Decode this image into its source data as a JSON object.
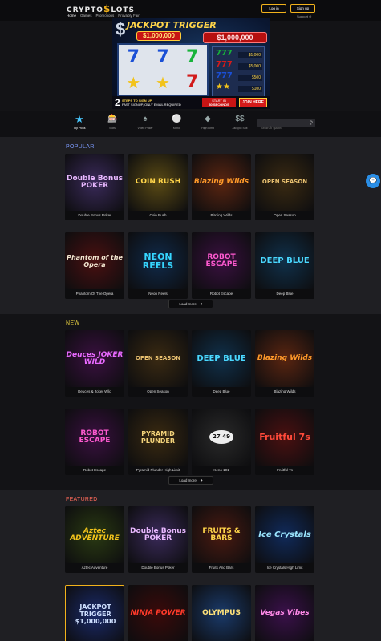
{
  "header": {
    "logo_left": "CRYPTO",
    "logo_mid": "$",
    "logo_right": "LOTS",
    "nav": [
      "Home",
      "Games",
      "Promotions",
      "Provably Fair"
    ],
    "login": "Log in",
    "signup": "Sign up",
    "support": "Support"
  },
  "banner": {
    "title": "JACKPOT TRIGGER",
    "amount": "$1,000,000",
    "amount2": "$1,000,000",
    "mini_pays": [
      "$1,000",
      "$5,000",
      "$500",
      "$100"
    ],
    "step_num": "2",
    "step_line1": "STEPS TO SIGN UP",
    "step_line2": "FAST SIGNUP, ONLY EMAIL REQUIRED",
    "timer_line1": "START IN",
    "timer_line2": "30 SECONDS",
    "join": "JOIN HERE"
  },
  "categories": [
    {
      "label": "Top Picks",
      "icon": "star-icon"
    },
    {
      "label": "Slots",
      "icon": "slots-icon"
    },
    {
      "label": "Video Poker",
      "icon": "spade-icon"
    },
    {
      "label": "Keno",
      "icon": "keno-icon"
    },
    {
      "label": "High Limit",
      "icon": "high-limit-icon"
    },
    {
      "label": "Jackpot Slot",
      "icon": "jackpot-icon"
    }
  ],
  "search": {
    "placeholder": "Search game"
  },
  "popular": {
    "title": "POPULAR",
    "games": [
      {
        "name": "Double Bonus Poker",
        "art": "Double Bonus POKER"
      },
      {
        "name": "Coin Rush",
        "art": "COIN RUSH"
      },
      {
        "name": "Blazing Wilds",
        "art": "Blazing Wilds"
      },
      {
        "name": "Open Season",
        "art": "OPEN SEASON"
      },
      {
        "name": "Phantom Of The Opera",
        "art": "Phantom of the Opera"
      },
      {
        "name": "Neon Reels",
        "art": "NEON REELS"
      },
      {
        "name": "Robot Escape",
        "art": "ROBOT ESCAPE"
      },
      {
        "name": "Deep Blue",
        "art": "DEEP BLUE"
      }
    ],
    "load_more": "Load more"
  },
  "new": {
    "title": "NEW",
    "games": [
      {
        "name": "Deuces & Joker Wild",
        "art": "Deuces JOKER WILD"
      },
      {
        "name": "Open Season",
        "art": "OPEN SEASON"
      },
      {
        "name": "Deep Blue",
        "art": "DEEP BLUE"
      },
      {
        "name": "Blazing Wilds",
        "art": "Blazing Wilds"
      },
      {
        "name": "Robot Escape",
        "art": "ROBOT ESCAPE"
      },
      {
        "name": "Pyramid Plunder High Limit",
        "art": "PYRAMID PLUNDER"
      },
      {
        "name": "Keno 101",
        "art": "27 49"
      },
      {
        "name": "Fruitful 7s",
        "art": "Fruitful 7s"
      }
    ],
    "load_more": "Load more"
  },
  "featured": {
    "title": "FEATURED",
    "games": [
      {
        "name": "Aztec Adventure",
        "art": "Aztec ADVENTURE"
      },
      {
        "name": "Double Bonus Poker",
        "art": "Double Bonus POKER"
      },
      {
        "name": "Fruits And Bars",
        "art": "FRUITS & BARS"
      },
      {
        "name": "Ice Crystals High Limit",
        "art": "Ice Crystals"
      },
      {
        "name": "",
        "art": "JACKPOT TRIGGER $1,000,000"
      },
      {
        "name": "",
        "art": "NINJA POWER"
      },
      {
        "name": "",
        "art": "OLYMPUS"
      },
      {
        "name": "",
        "art": "Vegas Vibes"
      }
    ]
  },
  "colors": {
    "accent": "#f2b21b",
    "popular": "#7d9bff",
    "new": "#e8d040",
    "featured": "#ff6a5a"
  }
}
